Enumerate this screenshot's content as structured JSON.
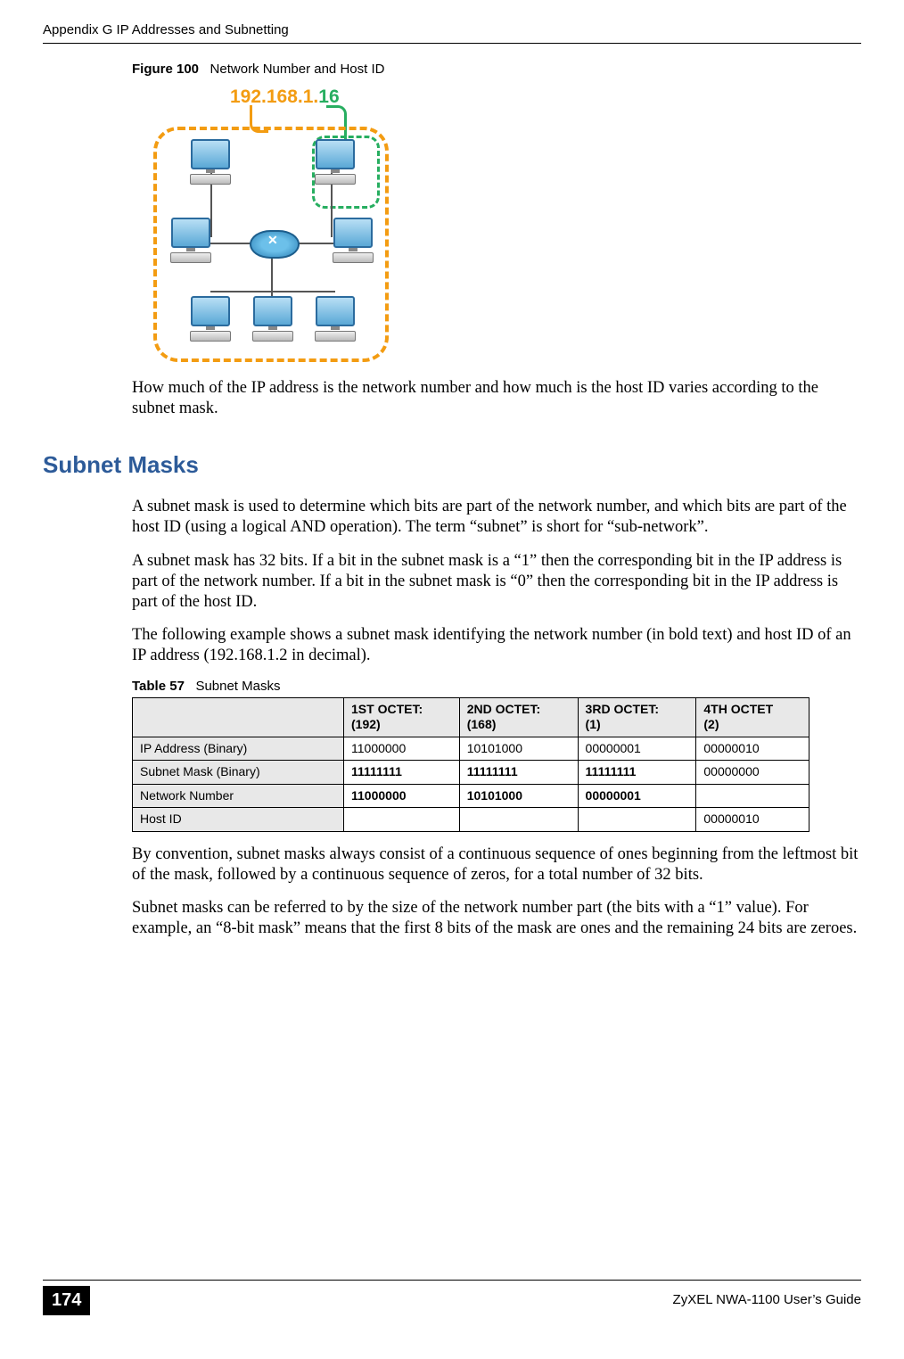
{
  "header": {
    "running": "Appendix G IP Addresses and Subnetting"
  },
  "figure": {
    "label": "Figure 100",
    "title": "Network Number and Host ID",
    "ip_network_part": "192.168.1.",
    "ip_host_part": "16"
  },
  "para": {
    "after_fig": "How much of the IP address is the network number and how much is the host ID varies according to the subnet mask.",
    "sm1": "A subnet mask is used to determine which bits are part of the network number, and which bits are part of the host ID (using a logical AND operation). The term “subnet” is short for “sub-network”.",
    "sm2": "A subnet mask has 32 bits. If a bit in the subnet mask is a “1” then the corresponding bit in the IP address is part of the network number. If a bit in the subnet mask is “0” then the corresponding bit in the IP address is part of the host ID.",
    "sm3": "The following example shows a subnet mask identifying the network number (in bold text) and host ID of an IP address (192.168.1.2 in decimal).",
    "after_tbl1": "By convention, subnet masks always consist of a continuous sequence of ones beginning from the leftmost bit of the mask, followed by a continuous sequence of zeros, for a total number of 32 bits.",
    "after_tbl2": "Subnet masks can be referred to by the size of the network number part (the bits with a “1” value). For example, an “8-bit mask” means that the first 8 bits of the mask are ones and the remaining 24 bits are zeroes."
  },
  "section": {
    "subnet_masks": "Subnet Masks"
  },
  "table": {
    "label": "Table 57",
    "title": "Subnet Masks",
    "head": {
      "c0": "",
      "c1a": "1ST OCTET:",
      "c1b": "(192)",
      "c2a": "2ND OCTET:",
      "c2b": "(168)",
      "c3a": "3RD OCTET:",
      "c3b": "(1)",
      "c4a": "4TH OCTET",
      "c4b": "(2)"
    },
    "rows": {
      "r1": {
        "h": "IP Address (Binary)",
        "c1": "11000000",
        "c2": "10101000",
        "c3": "00000001",
        "c4": "00000010"
      },
      "r2": {
        "h": "Subnet Mask (Binary)",
        "c1": "11111111",
        "c2": "11111111",
        "c3": "11111111",
        "c4": "00000000"
      },
      "r3": {
        "h": "Network Number",
        "c1": "11000000",
        "c2": "10101000",
        "c3": "00000001",
        "c4": ""
      },
      "r4": {
        "h": "Host ID",
        "c1": "",
        "c2": "",
        "c3": "",
        "c4": "00000010"
      }
    }
  },
  "footer": {
    "page": "174",
    "guide": "ZyXEL NWA-1100 User’s Guide"
  },
  "chart_data": {
    "type": "table",
    "title": "Subnet Masks",
    "columns": [
      "",
      "1ST OCTET: (192)",
      "2ND OCTET: (168)",
      "3RD OCTET: (1)",
      "4TH OCTET (2)"
    ],
    "rows": [
      [
        "IP Address (Binary)",
        "11000000",
        "10101000",
        "00000001",
        "00000010"
      ],
      [
        "Subnet Mask (Binary)",
        "11111111",
        "11111111",
        "11111111",
        "00000000"
      ],
      [
        "Network Number",
        "11000000",
        "10101000",
        "00000001",
        ""
      ],
      [
        "Host ID",
        "",
        "",
        "",
        "00000010"
      ]
    ],
    "bold_cells": [
      [
        1,
        1
      ],
      [
        1,
        2
      ],
      [
        1,
        3
      ],
      [
        2,
        1
      ],
      [
        2,
        2
      ],
      [
        2,
        3
      ]
    ]
  }
}
